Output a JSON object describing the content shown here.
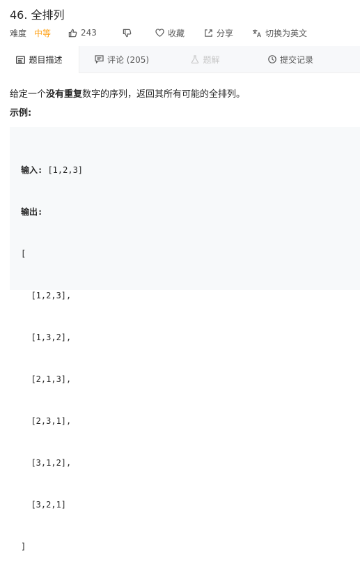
{
  "problem": {
    "title": "46. 全排列",
    "difficulty_label": "难度",
    "difficulty": "中等",
    "likes": "243",
    "favorite_label": "收藏",
    "share_label": "分享",
    "translate_label": "切换为英文"
  },
  "tabs": [
    {
      "label": "题目描述",
      "icon": "description-icon",
      "active": true
    },
    {
      "label": "评论 (205)",
      "icon": "comment-icon",
      "active": false
    },
    {
      "label": "题解",
      "icon": "flask-icon",
      "active": false,
      "disabled": true
    },
    {
      "label": "提交记录",
      "icon": "clock-icon",
      "active": false
    }
  ],
  "description": {
    "prefix": "给定一个",
    "bold": "没有重复",
    "suffix": "数字的序列，返回其所有可能的全排列。"
  },
  "example": {
    "label": "示例:",
    "input_label": "输入:",
    "input_value": " [1,2,3]",
    "output_label": "输出:",
    "output_lines": [
      "[",
      "  [1,2,3],",
      "  [1,3,2],",
      "  [2,1,3],",
      "  [2,3,1],",
      "  [3,1,2],",
      "  [3,2,1]",
      "]"
    ]
  },
  "colors": {
    "difficulty_medium": "#ffa116",
    "tabbar_bg": "#f7f8fa",
    "code_bg": "#f7f9fa"
  }
}
